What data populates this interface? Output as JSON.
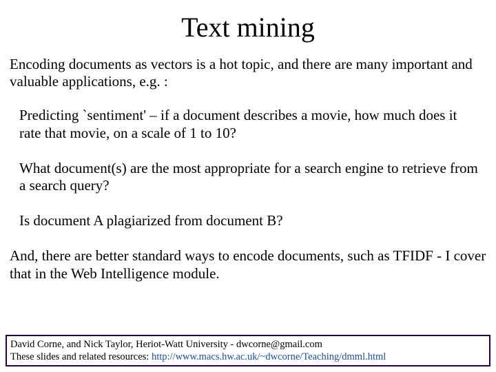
{
  "title": "Text mining",
  "intro": "Encoding documents as vectors is a hot topic, and there are many important and valuable applications, e.g. :",
  "bullets": [
    "Predicting `sentiment' – if a document describes a movie, how much does it rate that movie, on a scale of 1 to 10?",
    "What document(s) are the most appropriate for a search engine to retrieve from a search query?",
    "Is document A plagiarized from document B?"
  ],
  "outro": "And, there are better standard ways to encode documents, such as TFIDF - I cover that in the Web Intelligence module.",
  "footer": {
    "line1": "David Corne, and Nick Taylor,  Heriot-Watt University  -  dwcorne@gmail.com",
    "line2_prefix": "These slides and related resources:   ",
    "line2_link": "http://www.macs.hw.ac.uk/~dwcorne/Teaching/dmml.html"
  }
}
